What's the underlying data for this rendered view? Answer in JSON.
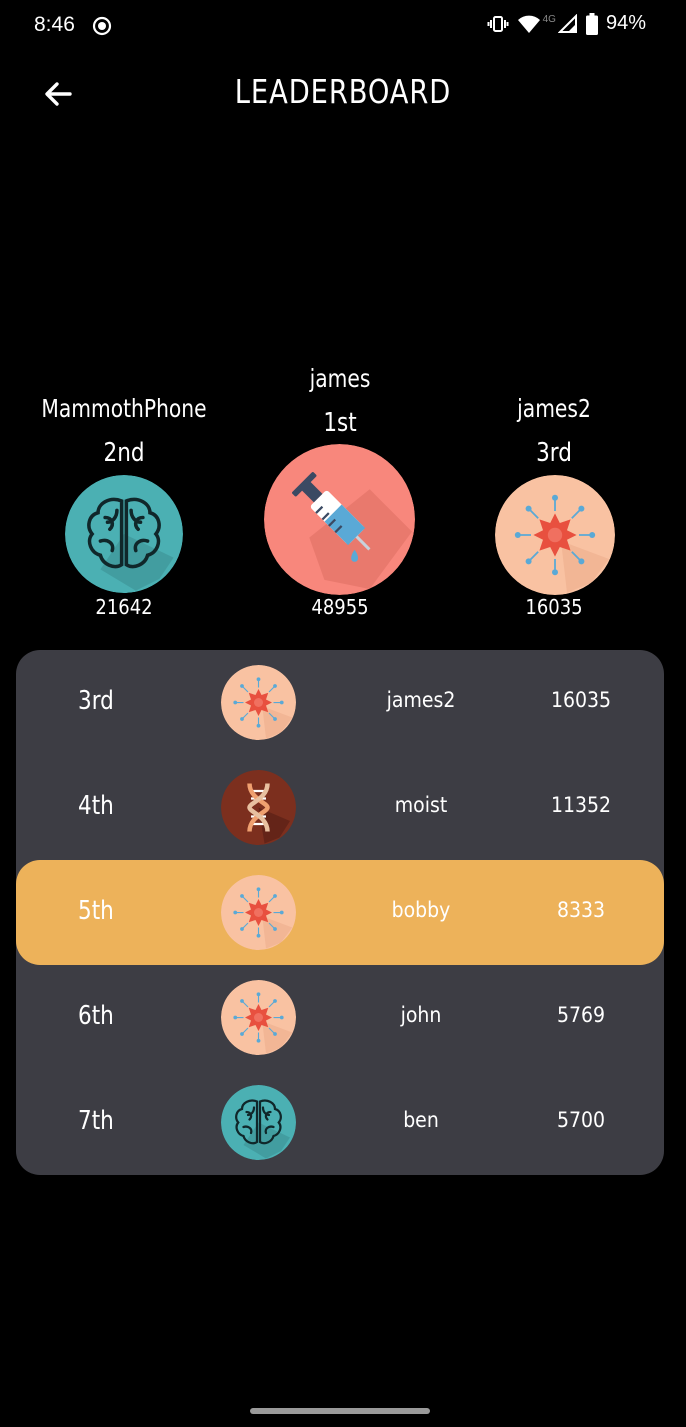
{
  "status_bar": {
    "time": "8:46",
    "network": "4G",
    "battery": "94%"
  },
  "header": {
    "title": "LEADERBOARD"
  },
  "podium": {
    "first": {
      "name": "james",
      "rank": "1st",
      "score": "48955",
      "avatar": "syringe-icon"
    },
    "second": {
      "name": "MammothPhone",
      "rank": "2nd",
      "score": "21642",
      "avatar": "brain-icon"
    },
    "third": {
      "name": "james2",
      "rank": "3rd",
      "score": "16035",
      "avatar": "virus-icon"
    }
  },
  "rows": [
    {
      "rank": "3rd",
      "name": "james2",
      "score": "16035",
      "avatar": "virus-icon",
      "highlighted": false
    },
    {
      "rank": "4th",
      "name": "moist",
      "score": "11352",
      "avatar": "dna-icon",
      "highlighted": false
    },
    {
      "rank": "5th",
      "name": "bobby",
      "score": "8333",
      "avatar": "virus-icon",
      "highlighted": true
    },
    {
      "rank": "6th",
      "name": "john",
      "score": "5769",
      "avatar": "virus-icon",
      "highlighted": false
    },
    {
      "rank": "7th",
      "name": "ben",
      "score": "5700",
      "avatar": "brain-icon",
      "highlighted": false
    }
  ],
  "colors": {
    "background": "#000000",
    "panel": "#3d3d44",
    "highlight": "#edb25a",
    "brain_bg": "#4bb0b3",
    "syringe_bg": "#f8877c",
    "virus_bg": "#f9c2a2",
    "dna_bg": "#7c2f1e"
  }
}
